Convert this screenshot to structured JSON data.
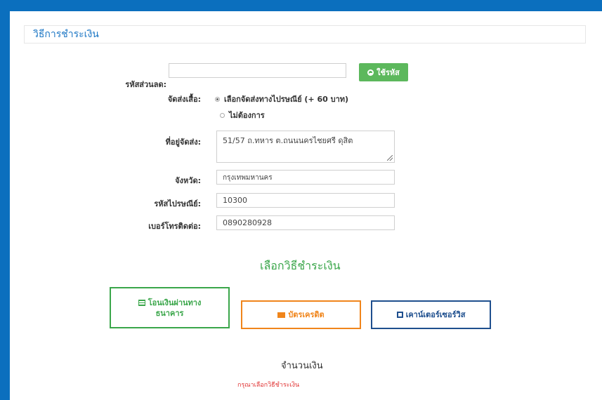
{
  "section_title": "วิธีการชำระเงิน",
  "discount": {
    "label": "รหัสส่วนลด:",
    "value": "",
    "button_label": "ใช้รหัส"
  },
  "shipping": {
    "label": "จัดส่งเสื้อ:",
    "options": [
      {
        "label": "เลือกจัดส่งทางไปรษณีย์ (+ 60 บาท)",
        "checked": true
      },
      {
        "label": "ไม่ต้องการ",
        "checked": false
      }
    ]
  },
  "address": {
    "label": "ที่อยู่จัดส่ง:",
    "value": "51/57 ถ.ทหาร ต.ถนนนครไชยศรี ดุสิต"
  },
  "province": {
    "label": "จังหวัด:",
    "value": "กรุงเทพมหานคร"
  },
  "postcode": {
    "label": "รหัสไปรษณีย์:",
    "value": "10300"
  },
  "phone": {
    "label": "เบอร์โทรติดต่อ:",
    "value": "0890280928"
  },
  "payment": {
    "heading": "เลือกวิธีชำระเงิน",
    "bank_line1": "โอนเงินผ่านทาง",
    "bank_line2": "ธนาคาร",
    "card": "บัตรเครดิต",
    "counter": "เคาน์เตอร์เซอร์วิส"
  },
  "amount": {
    "label": "จำนวนเงิน",
    "note": "กรุณาเลือกวิธีชำระเงิน"
  },
  "colors": {
    "page_bg": "#0b6fbe",
    "accent_blue": "#1d77c5",
    "accent_green": "#3aa64a",
    "accent_orange": "#f0851b",
    "accent_navy": "#1e4f8e",
    "error_red": "#e03030"
  },
  "icons": {
    "use_code": "minus-circle-icon",
    "bank": "list-icon",
    "card": "credit-card-icon",
    "counter": "square-icon"
  }
}
